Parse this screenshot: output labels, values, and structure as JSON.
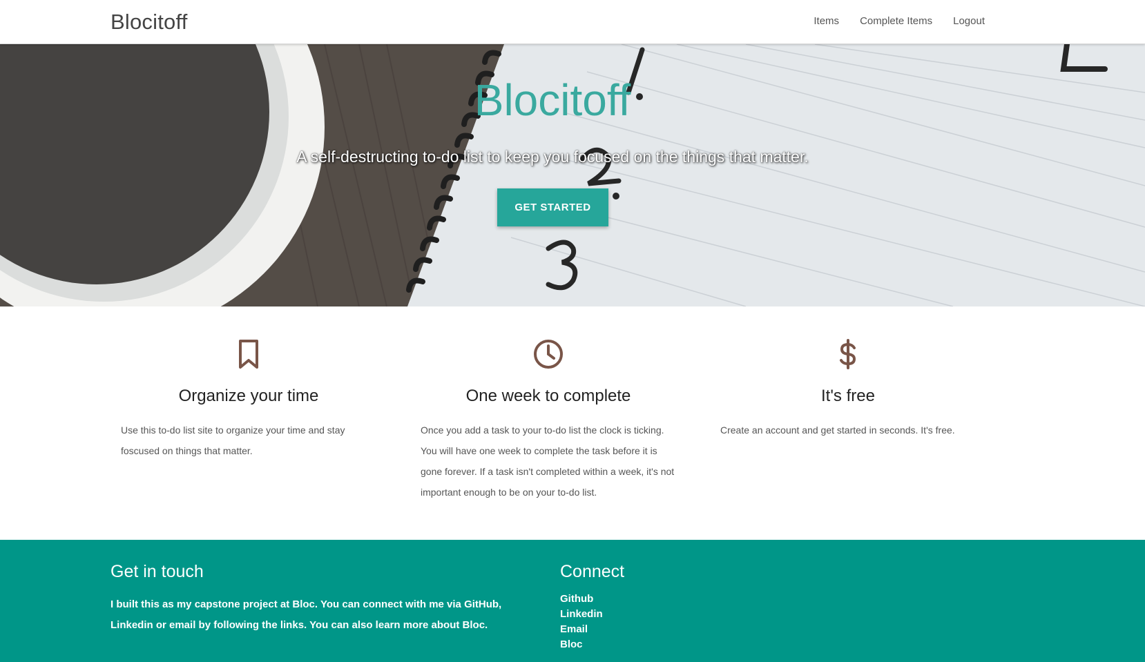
{
  "nav": {
    "brand": "Blocitoff",
    "links": [
      "Items",
      "Complete Items",
      "Logout"
    ]
  },
  "hero": {
    "title": "Blocitoff",
    "subtitle": "A self-destructing to-do list to keep you focused on the things that matter.",
    "cta_label": "GET STARTED",
    "notebook_marks": [
      "1.",
      "2.",
      "3."
    ]
  },
  "features": [
    {
      "icon": "bookmark-icon",
      "title": "Organize your time",
      "text": "Use this to-do list site to organize your time and stay foscused on things that matter."
    },
    {
      "icon": "clock-icon",
      "title": "One week to complete",
      "text": "Once you add a task to your to-do list the clock is ticking. You will have one week to complete the task before it is gone forever. If a task isn't completed within a week, it's not important enough to be on your to-do list."
    },
    {
      "icon": "dollar-icon",
      "title": "It's free",
      "text": "Create an account and get started in seconds. It's free."
    }
  ],
  "footer": {
    "contact_heading": "Get in touch",
    "contact_text": "I built this as my capstone project at Bloc. You can connect with me via GitHub, Linkedin or email by following the links. You can also learn more about Bloc.",
    "connect_heading": "Connect",
    "links": [
      "Github",
      "Linkedin",
      "Email",
      "Bloc"
    ]
  },
  "colors": {
    "accent": "#26a69a",
    "footer_bg": "#009688",
    "hero_title": "#3aa99f",
    "icon_brown": "#795548"
  }
}
